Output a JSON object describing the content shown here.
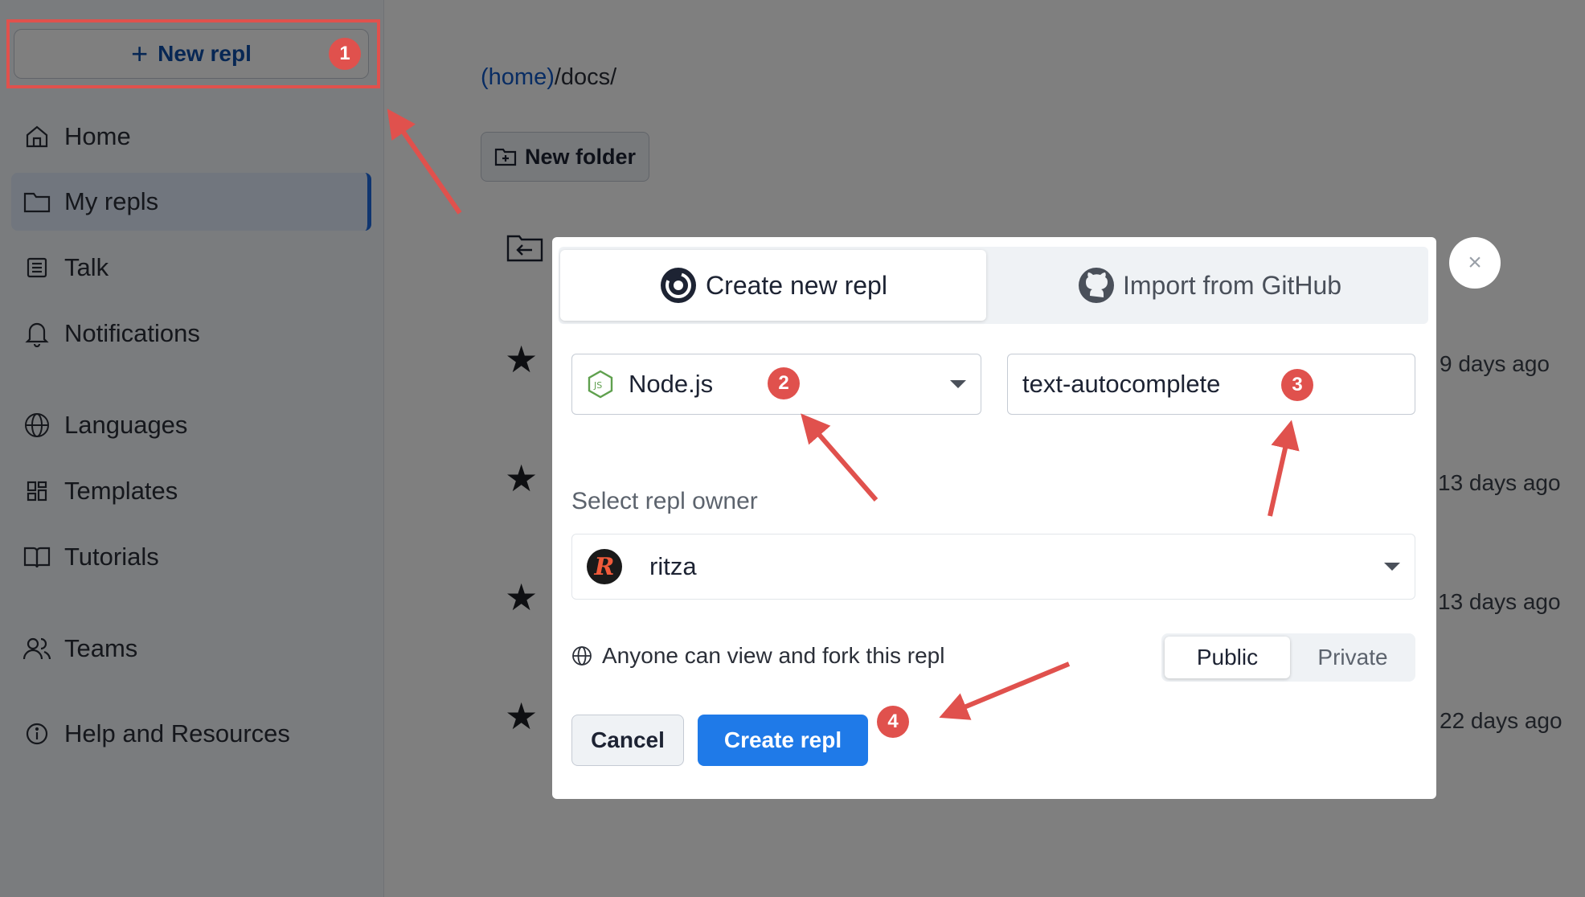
{
  "sidebar": {
    "new_repl_label": "New repl",
    "items": [
      {
        "label": "Home",
        "icon": "home-icon"
      },
      {
        "label": "My repls",
        "icon": "folder-icon"
      },
      {
        "label": "Talk",
        "icon": "talk-icon"
      },
      {
        "label": "Notifications",
        "icon": "bell-icon"
      },
      {
        "label": "Languages",
        "icon": "globe-icon"
      },
      {
        "label": "Templates",
        "icon": "templates-icon"
      },
      {
        "label": "Tutorials",
        "icon": "book-icon"
      },
      {
        "label": "Teams",
        "icon": "users-icon"
      },
      {
        "label": "Help and Resources",
        "icon": "info-icon"
      }
    ]
  },
  "main": {
    "breadcrumb_home": "(home)",
    "breadcrumb_rest": "/docs/",
    "new_folder_label": "New folder",
    "rows": [
      {
        "date": "9 days ago"
      },
      {
        "date": "13 days ago"
      },
      {
        "date": "13 days ago"
      },
      {
        "date": "22 days ago"
      }
    ]
  },
  "modal": {
    "tab_create": "Create new repl",
    "tab_import": "Import from GitHub",
    "language_value": "Node.js",
    "name_value": "text-autocomplete",
    "owner_label": "Select repl owner",
    "owner_value": "ritza",
    "owner_avatar_letter": "R",
    "visibility_text": "Anyone can view and fork this repl",
    "visibility_public": "Public",
    "visibility_private": "Private",
    "cancel_label": "Cancel",
    "create_label": "Create repl",
    "close_symbol": "×"
  },
  "annotations": {
    "badge_1": "1",
    "badge_2": "2",
    "badge_3": "3",
    "badge_4": "4",
    "color": "#e0514d"
  },
  "colors": {
    "accent": "#1f7ae8",
    "link": "#1158c7",
    "sidebar_active": "#e2ecfc"
  }
}
